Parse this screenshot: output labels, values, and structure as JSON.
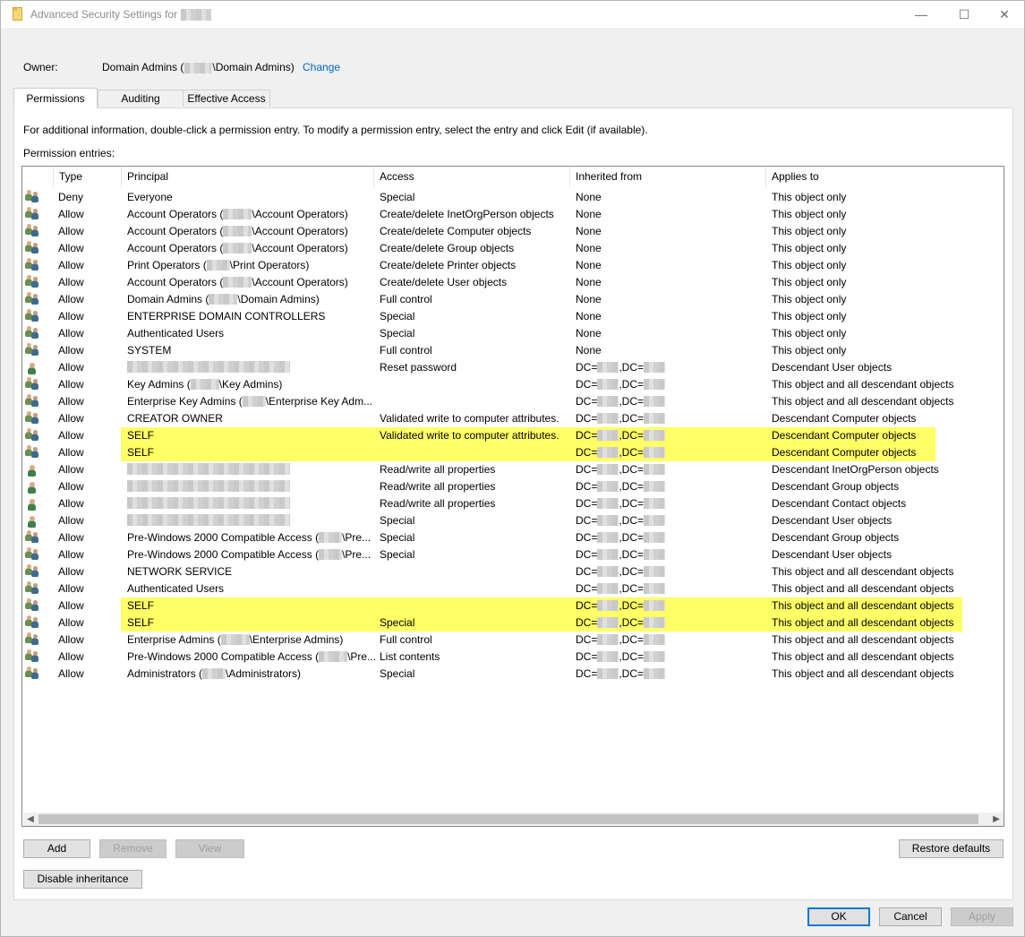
{
  "window": {
    "title": "Advanced Security Settings for",
    "controls": {
      "minimize": "—",
      "maximize": "☐",
      "close": "✕"
    }
  },
  "owner": {
    "label": "Owner:",
    "name_prefix": "Domain Admins (",
    "name_suffix": "\\Domain Admins)",
    "change_link": "Change"
  },
  "tabs": [
    {
      "label": "Permissions",
      "active": true
    },
    {
      "label": "Auditing",
      "active": false
    },
    {
      "label": "Effective Access",
      "active": false
    }
  ],
  "permissions": {
    "info_text": "For additional information, double-click a permission entry. To modify a permission entry, select the entry and click Edit (if available).",
    "entries_label": "Permission entries:",
    "columns": [
      "Type",
      "Principal",
      "Access",
      "Inherited from",
      "Applies to"
    ],
    "rows": [
      {
        "icon": "group-icon",
        "type": "Deny",
        "principal": [
          {
            "t": "Everyone"
          }
        ],
        "access": "Special",
        "inherited": "None",
        "applies": "This object only"
      },
      {
        "icon": "group-icon",
        "type": "Allow",
        "principal": [
          {
            "t": "Account Operators ("
          },
          {
            "r": "a"
          },
          {
            "t": "\\Account Operators)"
          }
        ],
        "access": "Create/delete InetOrgPerson objects",
        "inherited": "None",
        "applies": "This object only"
      },
      {
        "icon": "group-icon",
        "type": "Allow",
        "principal": [
          {
            "t": "Account Operators ("
          },
          {
            "r": "a"
          },
          {
            "t": "\\Account Operators)"
          }
        ],
        "access": "Create/delete Computer objects",
        "inherited": "None",
        "applies": "This object only"
      },
      {
        "icon": "group-icon",
        "type": "Allow",
        "principal": [
          {
            "t": "Account Operators ("
          },
          {
            "r": "a"
          },
          {
            "t": "\\Account Operators)"
          }
        ],
        "access": "Create/delete Group objects",
        "inherited": "None",
        "applies": "This object only"
      },
      {
        "icon": "group-icon",
        "type": "Allow",
        "principal": [
          {
            "t": "Print Operators ("
          },
          {
            "r": "b"
          },
          {
            "t": "\\Print Operators)"
          }
        ],
        "access": "Create/delete Printer objects",
        "inherited": "None",
        "applies": "This object only"
      },
      {
        "icon": "group-icon",
        "type": "Allow",
        "principal": [
          {
            "t": "Account Operators ("
          },
          {
            "r": "a"
          },
          {
            "t": "\\Account Operators)"
          }
        ],
        "access": "Create/delete User objects",
        "inherited": "None",
        "applies": "This object only"
      },
      {
        "icon": "group-icon",
        "type": "Allow",
        "principal": [
          {
            "t": "Domain Admins ("
          },
          {
            "r": "a"
          },
          {
            "t": "\\Domain Admins)"
          }
        ],
        "access": "Full control",
        "inherited": "None",
        "applies": "This object only"
      },
      {
        "icon": "group-icon",
        "type": "Allow",
        "principal": [
          {
            "t": "ENTERPRISE DOMAIN CONTROLLERS"
          }
        ],
        "access": "Special",
        "inherited": "None",
        "applies": "This object only"
      },
      {
        "icon": "group-icon",
        "type": "Allow",
        "principal": [
          {
            "t": "Authenticated Users"
          }
        ],
        "access": "Special",
        "inherited": "None",
        "applies": "This object only"
      },
      {
        "icon": "group-icon",
        "type": "Allow",
        "principal": [
          {
            "t": "SYSTEM"
          }
        ],
        "access": "Full control",
        "inherited": "None",
        "applies": "This object only"
      },
      {
        "icon": "user-icon",
        "type": "Allow",
        "principal": [
          {
            "r": "big"
          }
        ],
        "access": "Reset password",
        "inherited": "dc",
        "applies": "Descendant User objects"
      },
      {
        "icon": "group-icon",
        "type": "Allow",
        "principal": [
          {
            "t": "Key Admins ("
          },
          {
            "r": "a"
          },
          {
            "t": "\\Key Admins)"
          }
        ],
        "access": "",
        "inherited": "dc",
        "applies": "This object and all descendant objects"
      },
      {
        "icon": "group-icon",
        "type": "Allow",
        "principal": [
          {
            "t": "Enterprise Key Admins ("
          },
          {
            "r": "b"
          },
          {
            "t": "\\Enterprise Key Adm..."
          }
        ],
        "access": "",
        "inherited": "dc",
        "applies": "This object and all descendant objects"
      },
      {
        "icon": "group-icon",
        "type": "Allow",
        "principal": [
          {
            "t": "CREATOR OWNER"
          }
        ],
        "access": "Validated write to computer attributes.",
        "inherited": "dc",
        "applies": "Descendant Computer objects"
      },
      {
        "icon": "group-icon",
        "type": "Allow",
        "principal": [
          {
            "t": "SELF"
          }
        ],
        "access": "Validated write to computer attributes.",
        "inherited": "dc",
        "applies": "Descendant Computer objects",
        "highlight": [
          110,
          1020
        ]
      },
      {
        "icon": "group-icon",
        "type": "Allow",
        "principal": [
          {
            "t": "SELF"
          }
        ],
        "access": "",
        "inherited": "dc",
        "applies": "Descendant Computer objects",
        "highlight": [
          110,
          1020
        ]
      },
      {
        "icon": "user-icon",
        "type": "Allow",
        "principal": [
          {
            "r": "big"
          }
        ],
        "access": "Read/write all properties",
        "inherited": "dc",
        "applies": "Descendant InetOrgPerson objects"
      },
      {
        "icon": "user-icon",
        "type": "Allow",
        "principal": [
          {
            "r": "big"
          }
        ],
        "access": "Read/write all properties",
        "inherited": "dc",
        "applies": "Descendant Group objects"
      },
      {
        "icon": "user-icon",
        "type": "Allow",
        "principal": [
          {
            "r": "big"
          }
        ],
        "access": "Read/write all properties",
        "inherited": "dc",
        "applies": "Descendant Contact objects"
      },
      {
        "icon": "user-icon",
        "type": "Allow",
        "principal": [
          {
            "r": "big"
          }
        ],
        "access": "Special",
        "inherited": "dc",
        "applies": "Descendant User objects"
      },
      {
        "icon": "group-icon",
        "type": "Allow",
        "principal": [
          {
            "t": "Pre-Windows 2000 Compatible Access ("
          },
          {
            "r": "b"
          },
          {
            "t": "\\Pre..."
          }
        ],
        "access": "Special",
        "inherited": "dc",
        "applies": "Descendant Group objects"
      },
      {
        "icon": "group-icon",
        "type": "Allow",
        "principal": [
          {
            "t": "Pre-Windows 2000 Compatible Access ("
          },
          {
            "r": "b"
          },
          {
            "t": "\\Pre..."
          }
        ],
        "access": "Special",
        "inherited": "dc",
        "applies": "Descendant User objects"
      },
      {
        "icon": "group-icon",
        "type": "Allow",
        "principal": [
          {
            "t": "NETWORK SERVICE"
          }
        ],
        "access": "",
        "inherited": "dc",
        "applies": "This object and all descendant objects"
      },
      {
        "icon": "group-icon",
        "type": "Allow",
        "principal": [
          {
            "t": "Authenticated Users"
          }
        ],
        "access": "",
        "inherited": "dc",
        "applies": "This object and all descendant objects"
      },
      {
        "icon": "group-icon",
        "type": "Allow",
        "principal": [
          {
            "t": "SELF"
          }
        ],
        "access": "",
        "inherited": "dc",
        "applies": "This object and all descendant objects",
        "highlight": [
          110,
          1050
        ]
      },
      {
        "icon": "group-icon",
        "type": "Allow",
        "principal": [
          {
            "t": "SELF"
          }
        ],
        "access": "Special",
        "inherited": "dc",
        "applies": "This object and all descendant objects",
        "highlight": [
          110,
          1050
        ]
      },
      {
        "icon": "group-icon",
        "type": "Allow",
        "principal": [
          {
            "t": "Enterprise Admins ("
          },
          {
            "r": "a"
          },
          {
            "t": "\\Enterprise Admins)"
          }
        ],
        "access": "Full control",
        "inherited": "dc",
        "applies": "This object and all descendant objects"
      },
      {
        "icon": "group-icon",
        "type": "Allow",
        "principal": [
          {
            "t": "Pre-Windows 2000 Compatible Access ("
          },
          {
            "r": "a"
          },
          {
            "t": "\\Pre..."
          }
        ],
        "access": "List contents",
        "inherited": "dc",
        "applies": "This object and all descendant objects"
      },
      {
        "icon": "group-icon",
        "type": "Allow",
        "principal": [
          {
            "t": "Administrators ("
          },
          {
            "r": "b"
          },
          {
            "t": "\\Administrators)"
          }
        ],
        "access": "Special",
        "inherited": "dc",
        "applies": "This object and all descendant objects"
      }
    ]
  },
  "buttons": {
    "add": "Add",
    "remove": "Remove",
    "view": "View",
    "restore_defaults": "Restore defaults",
    "disable_inheritance": "Disable inheritance",
    "ok": "OK",
    "cancel": "Cancel",
    "apply": "Apply"
  },
  "colors": {
    "highlight": "#ffff66",
    "link": "#0067c0",
    "ok_border": "#0078d7"
  }
}
